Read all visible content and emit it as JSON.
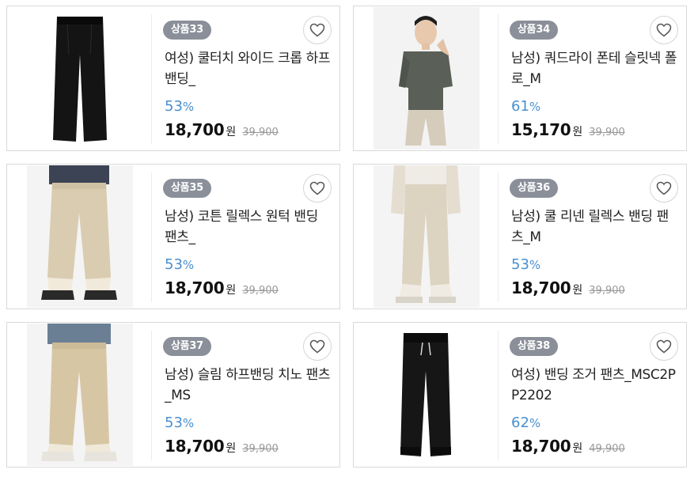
{
  "products": [
    {
      "badge": "상품33",
      "title": "여성) 쿨터치 와이드 크롭 하프밴딩_",
      "discount": "53",
      "discount_unit": "%",
      "price": "18,700",
      "currency": "원",
      "original_price": "39,900",
      "image": "black-wide-pants",
      "favorite_icon": "heart-icon"
    },
    {
      "badge": "상품34",
      "title": "남성) 쿼드라이 폰테 슬릿넥 폴로_M",
      "discount": "61",
      "discount_unit": "%",
      "price": "15,170",
      "currency": "원",
      "original_price": "39,900",
      "image": "man-gray-polo-beige-pants",
      "favorite_icon": "heart-icon"
    },
    {
      "badge": "상품35",
      "title": "남성) 코튼 릴렉스 원턱 밴딩 팬츠_",
      "discount": "53",
      "discount_unit": "%",
      "price": "18,700",
      "currency": "원",
      "original_price": "39,900",
      "image": "beige-cotton-pants",
      "favorite_icon": "heart-icon"
    },
    {
      "badge": "상품36",
      "title": "남성) 쿨 리넨 릴렉스 밴딩 팬츠_M",
      "discount": "53",
      "discount_unit": "%",
      "price": "18,700",
      "currency": "원",
      "original_price": "39,900",
      "image": "beige-linen-pants",
      "favorite_icon": "heart-icon"
    },
    {
      "badge": "상품37",
      "title": "남성) 슬림 하프밴딩 치노 팬츠_MS",
      "discount": "53",
      "discount_unit": "%",
      "price": "18,700",
      "currency": "원",
      "original_price": "39,900",
      "image": "beige-chino-pants",
      "favorite_icon": "heart-icon"
    },
    {
      "badge": "상품38",
      "title": "여성) 밴딩 조거 팬츠_MSC2PP2202",
      "discount": "62",
      "discount_unit": "%",
      "price": "18,700",
      "currency": "원",
      "original_price": "49,900",
      "image": "black-jogger-pants",
      "favorite_icon": "heart-icon"
    }
  ],
  "colors": {
    "badge_bg": "#8a8f99",
    "discount": "#4a8fd0",
    "border": "#d9d9d9"
  }
}
